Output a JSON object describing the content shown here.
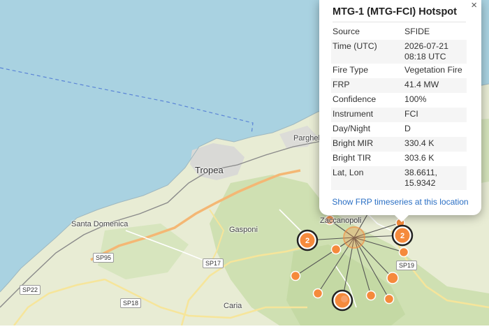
{
  "map": {
    "labels": {
      "tropea": "Tropea",
      "parghelia": "Parghel",
      "santa_domenica": "Santa Domenica",
      "gasponi": "Gasponi",
      "zungri": "Zaccanopoli",
      "caria": "Caria"
    },
    "roads": {
      "sp95": "SP95",
      "sp17": "SP17",
      "sp22": "SP22",
      "sp18": "SP18",
      "sp19": "SP19"
    },
    "clusters": {
      "left": "2",
      "right": "2"
    },
    "colors": {
      "sea": "#a9d2e1",
      "land": "#e7ecd3",
      "hotspot": "#f58a3c"
    }
  },
  "popup": {
    "title": "MTG-1 (MTG-FCI) Hotspot",
    "close": "×",
    "rows": [
      {
        "key": "Source",
        "value": "SFIDE"
      },
      {
        "key": "Time (UTC)",
        "value": "2026-07-21 08:18 UTC"
      },
      {
        "key": "Fire Type",
        "value": "Vegetation Fire"
      },
      {
        "key": "FRP",
        "value": "41.4 MW"
      },
      {
        "key": "Confidence",
        "value": "100%"
      },
      {
        "key": "Instrument",
        "value": "FCI"
      },
      {
        "key": "Day/Night",
        "value": "D"
      },
      {
        "key": "Bright MIR",
        "value": "330.4 K"
      },
      {
        "key": "Bright TIR",
        "value": "303.6 K"
      },
      {
        "key": "Lat, Lon",
        "value": "38.6611, 15.9342"
      }
    ],
    "link": "Show FRP timeseries at this location"
  }
}
